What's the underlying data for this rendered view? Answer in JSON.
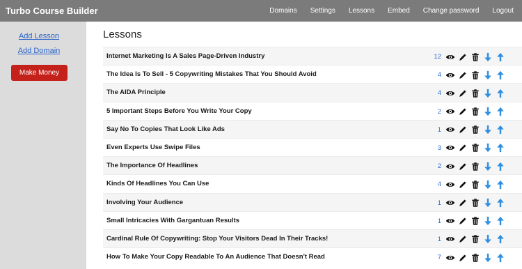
{
  "app": {
    "title": "Turbo Course Builder"
  },
  "nav": [
    {
      "label": "Domains"
    },
    {
      "label": "Settings"
    },
    {
      "label": "Lessons"
    },
    {
      "label": "Embed"
    },
    {
      "label": "Change password"
    },
    {
      "label": "Logout"
    }
  ],
  "sidebar": {
    "add_lesson": "Add Lesson",
    "add_domain": "Add Domain",
    "make_money": "Make Money"
  },
  "main": {
    "heading": "Lessons",
    "lessons": [
      {
        "title": "Internet Marketing Is A Sales Page-Driven Industry",
        "count": "12"
      },
      {
        "title": "The Idea Is To Sell - 5 Copywriting Mistakes That You Should Avoid",
        "count": "4"
      },
      {
        "title": "The AIDA Principle",
        "count": "4"
      },
      {
        "title": "5 Important Steps Before You Write Your Copy",
        "count": "2"
      },
      {
        "title": "Say No To Copies That Look Like Ads",
        "count": "1"
      },
      {
        "title": "Even Experts Use Swipe Files",
        "count": "3"
      },
      {
        "title": "The Importance Of Headlines",
        "count": "2"
      },
      {
        "title": "Kinds Of Headlines You Can Use",
        "count": "4"
      },
      {
        "title": "Involving Your Audience",
        "count": "1"
      },
      {
        "title": "Small Intricacies With Gargantuan Results",
        "count": "1"
      },
      {
        "title": "Cardinal Rule Of Copywriting: Stop Your Visitors Dead In Their Tracks!",
        "count": "1"
      },
      {
        "title": "How To Make Your Copy Readable To An Audience That Doesn't Read",
        "count": "7"
      }
    ]
  },
  "colors": {
    "topbar": "#7b7b7b",
    "sidebar": "#dcdcdc",
    "link": "#2a62c9",
    "button": "#c5211b",
    "arrow": "#2f8fe0",
    "count": "#2f6fd2"
  },
  "icons": [
    "eye-icon",
    "pencil-icon",
    "trash-icon",
    "arrow-down-icon",
    "arrow-up-icon"
  ]
}
